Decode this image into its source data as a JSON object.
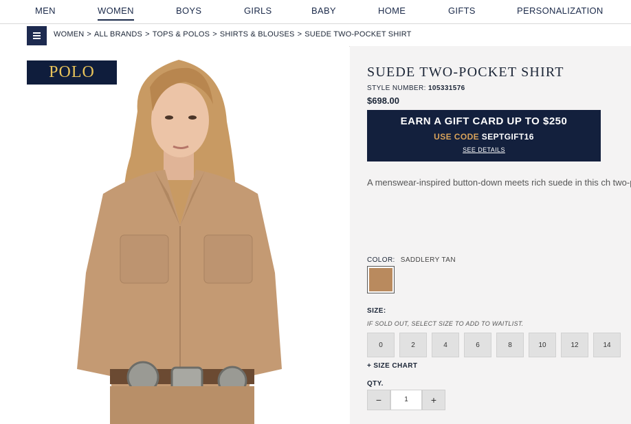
{
  "nav": {
    "items": [
      {
        "label": "MEN"
      },
      {
        "label": "WOMEN",
        "active": true
      },
      {
        "label": "BOYS"
      },
      {
        "label": "GIRLS"
      },
      {
        "label": "BABY"
      },
      {
        "label": "HOME"
      },
      {
        "label": "GIFTS"
      },
      {
        "label": "PERSONALIZATION"
      }
    ]
  },
  "breadcrumb": {
    "items": [
      "WOMEN",
      "ALL BRANDS",
      "TOPS & POLOS",
      "SHIRTS & BLOUSES",
      "SUEDE TWO-POCKET SHIRT"
    ],
    "separator": ">"
  },
  "icons": {
    "menu": "hamburger-menu-icon"
  },
  "brand": {
    "logo_text": "POLO",
    "logo_bg": "#0f1d3c",
    "logo_color": "#e8c35a"
  },
  "product": {
    "title": "SUEDE TWO-POCKET SHIRT",
    "style_label": "STYLE NUMBER:",
    "style_number": "105331576",
    "price": "$698.00",
    "description": "A menswear-inspired button-down meets rich suede in this ch two-pocket shirt."
  },
  "promo": {
    "headline": "EARN A GIFT CARD UP TO $250",
    "code_label": "USE CODE",
    "code": "SEPTGIFT16",
    "details_link": "SEE DETAILS"
  },
  "color": {
    "label": "COLOR:",
    "value": "SADDLERY TAN",
    "swatch_hex": "#b98a5e"
  },
  "size": {
    "label": "SIZE:",
    "note": "IF SOLD OUT, SELECT SIZE TO ADD TO WAITLIST.",
    "options": [
      "0",
      "2",
      "4",
      "6",
      "8",
      "10",
      "12",
      "14"
    ],
    "chart_link": "+ SIZE CHART"
  },
  "quantity": {
    "label": "QTY.",
    "value": "1",
    "minus": "−",
    "plus": "+"
  },
  "colors": {
    "navy": "#1d2a4f",
    "panel_bg": "#f4f3f3",
    "promo_gold": "#d9a35a"
  }
}
